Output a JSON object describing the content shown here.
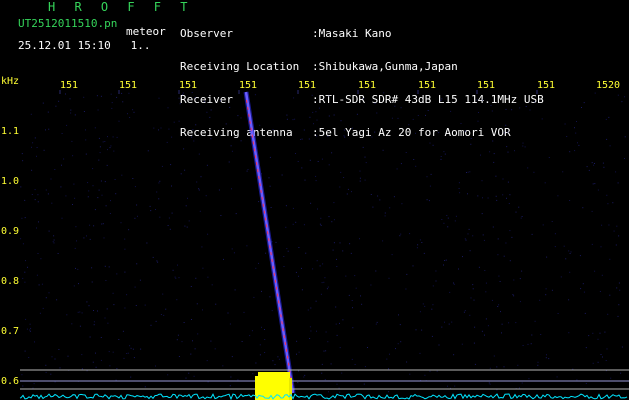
{
  "header": {
    "title": "H R O F F T",
    "filename": "UT2512011510.pn",
    "tag": "meteor",
    "datetime": "25.12.01 15:10   1..",
    "info": [
      {
        "label": "Observer",
        "value": ":Masaki Kano"
      },
      {
        "label": "Receiving Location",
        "value": ":Shibukawa,Gunma,Japan"
      },
      {
        "label": "Receiver",
        "value": ":RTL-SDR SDR# 43dB L15 114.1MHz USB"
      },
      {
        "label": "Receiving antenna",
        "value": ":5el Yagi Az 20 for Aomori VOR"
      }
    ]
  },
  "axes": {
    "y_unit": "kHz",
    "x_ticks": [
      "151",
      "151",
      "151",
      "151",
      "151",
      "151",
      "151",
      "151",
      "151",
      "1520"
    ],
    "y_ticks": [
      "1.1",
      "1.0",
      "0.9",
      "0.8",
      "0.7",
      "0.6"
    ]
  },
  "colors": {
    "background": "#000000",
    "text_yellow": "#ffff33",
    "text_green": "#35d45a",
    "trace": "#3a3aff",
    "trace_core": "#ff3355",
    "noise": "#00e5ff",
    "burst": "#ffff00"
  }
}
